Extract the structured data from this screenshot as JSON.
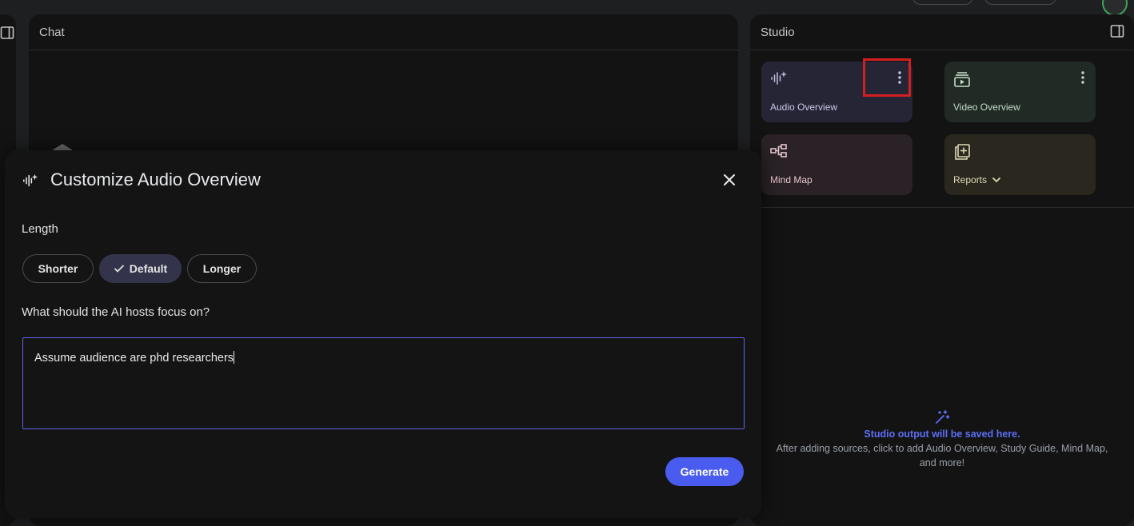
{
  "chat": {
    "title": "Chat"
  },
  "studio": {
    "title": "Studio",
    "cards": {
      "audio": "Audio Overview",
      "video": "Video Overview",
      "mind_map": "Mind Map",
      "reports": "Reports"
    },
    "empty_title": "Studio output will be saved here.",
    "empty_desc": "After adding sources, click to add Audio Overview, Study Guide, Mind Map, and more!"
  },
  "modal": {
    "title": "Customize Audio Overview",
    "length_label": "Length",
    "options": {
      "shorter": "Shorter",
      "default": "Default",
      "longer": "Longer"
    },
    "selected": "Default",
    "focus_label": "What should the AI hosts focus on?",
    "focus_value": "Assume audience are phd researchers",
    "generate_label": "Generate"
  },
  "colors": {
    "accent": "#4a5cf0",
    "selected_option": "#33344b",
    "highlight": "#d31f1f",
    "studio_link": "#5d6ef2"
  },
  "icons": {
    "modal": "audio-sparkle-icon",
    "close": "close-icon",
    "check": "check-icon",
    "more": "more-vert-icon"
  }
}
